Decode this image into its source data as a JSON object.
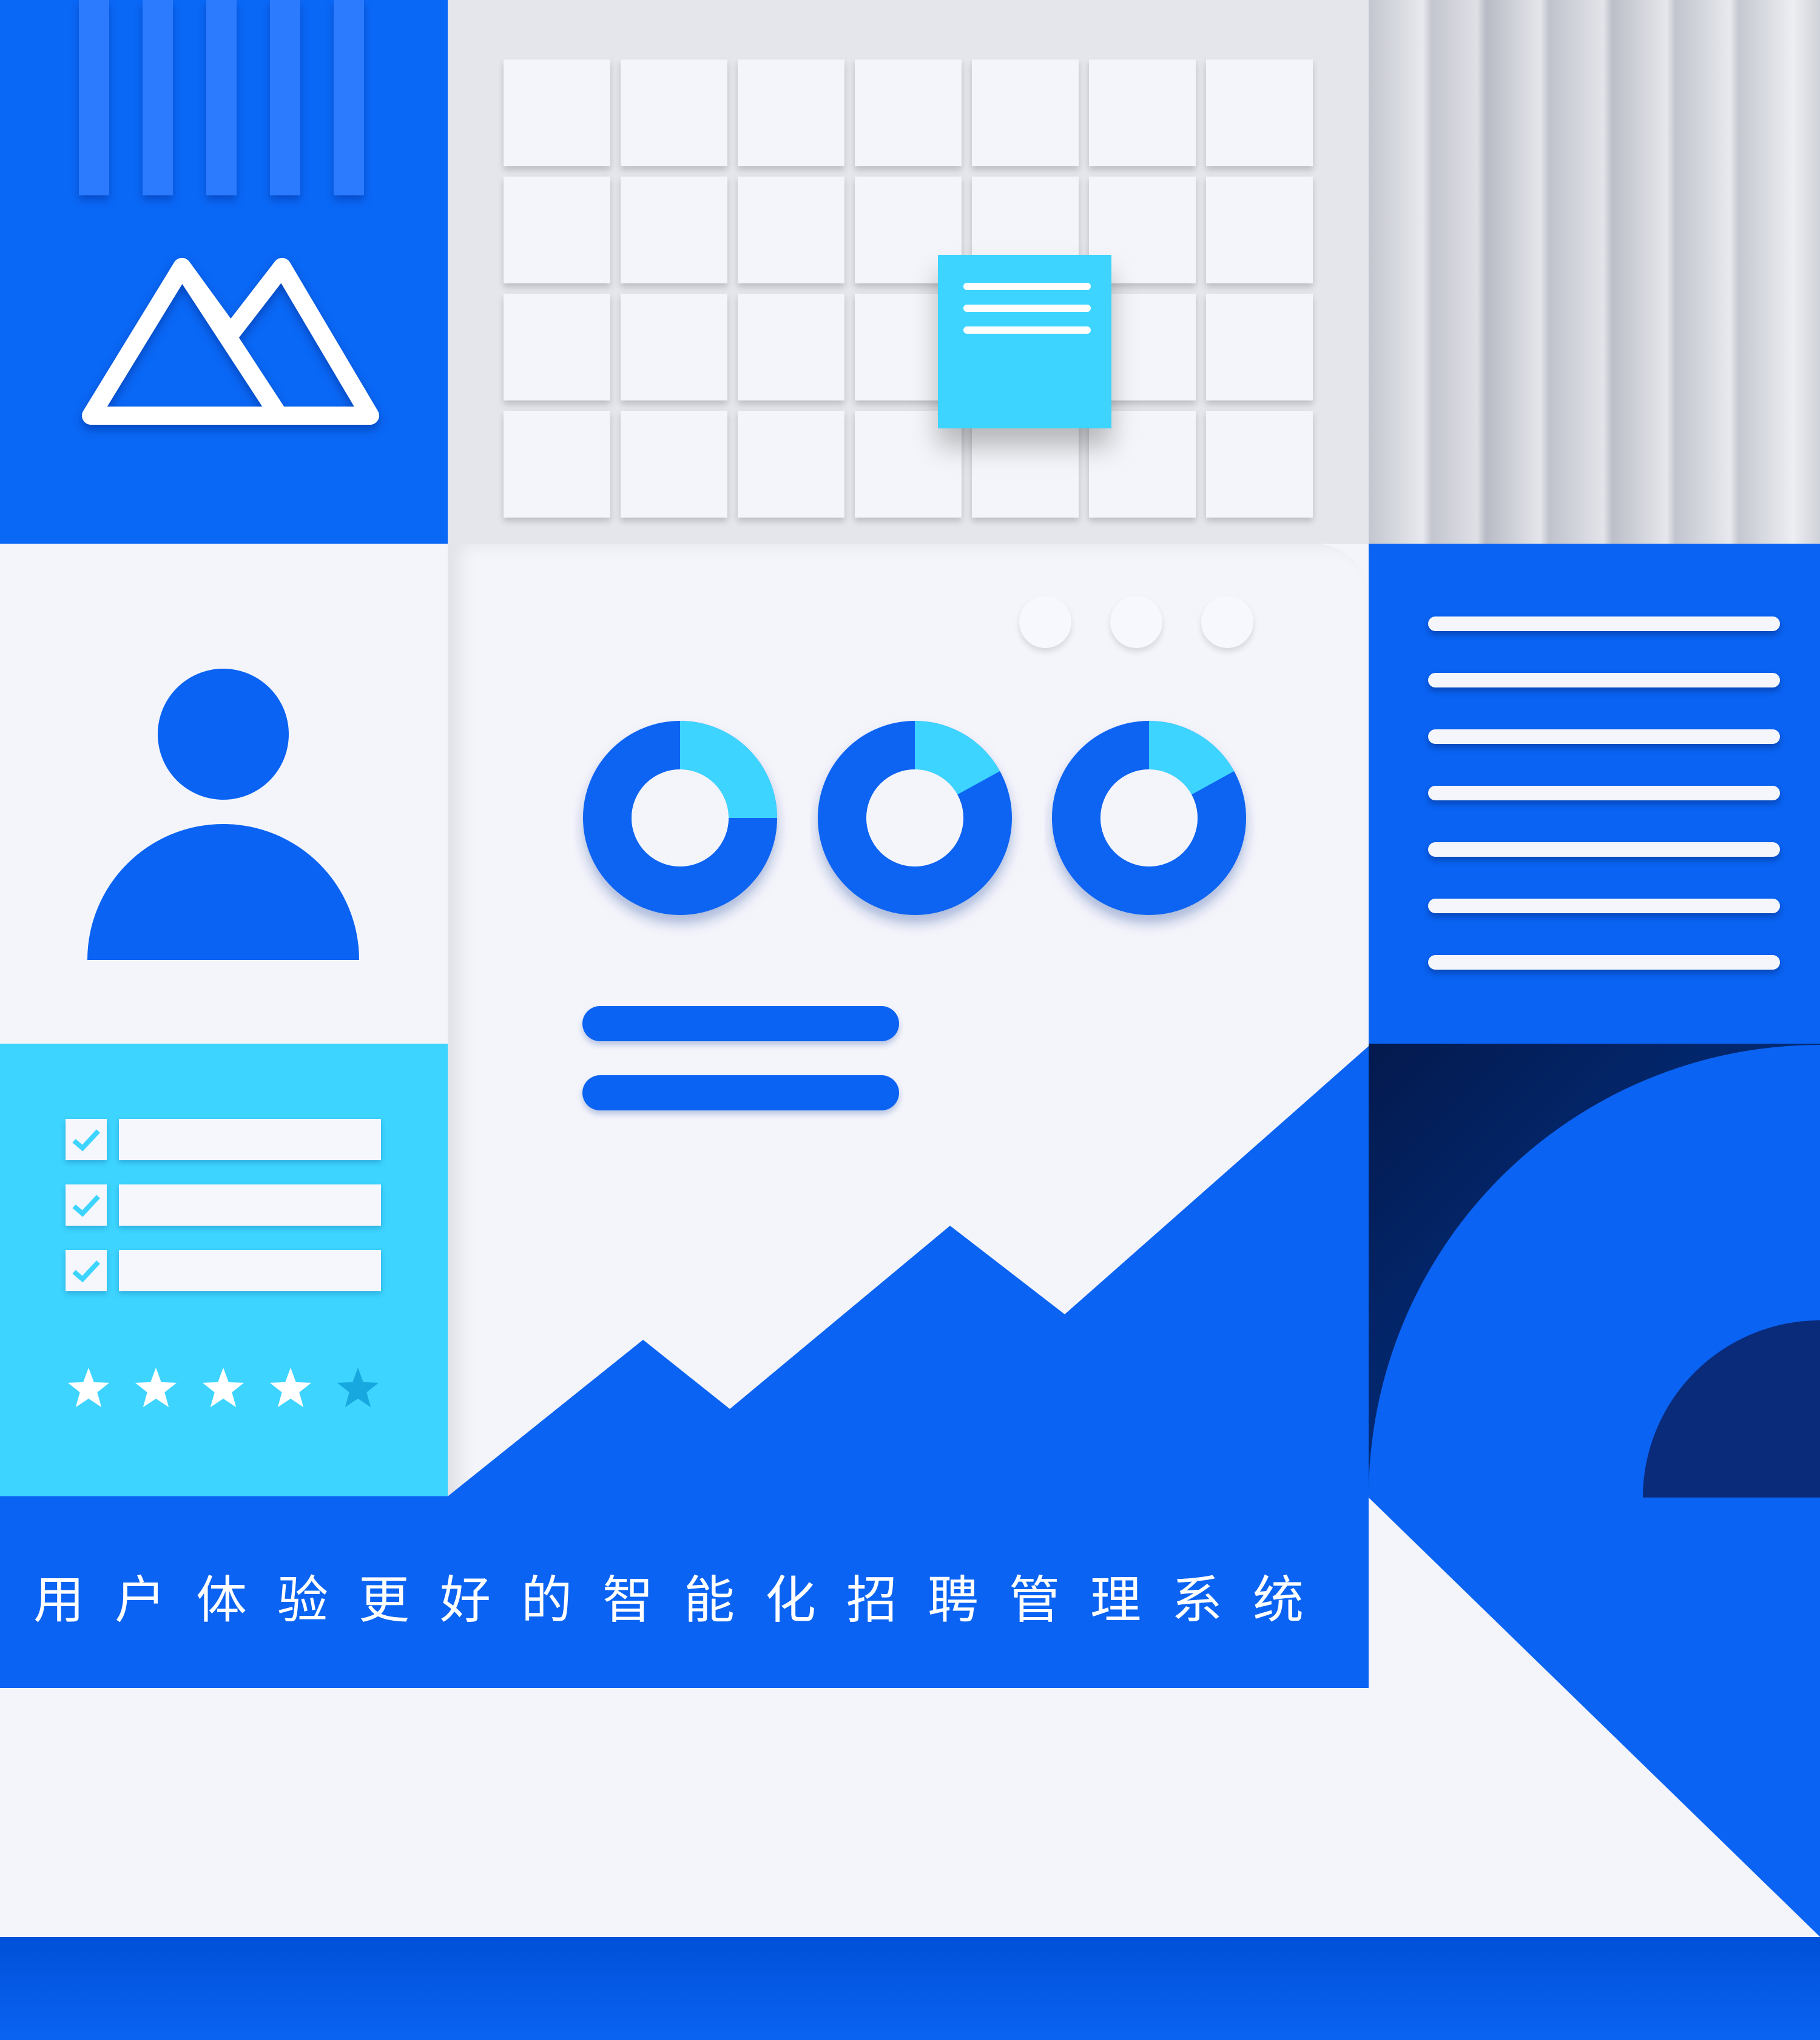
{
  "banner": {
    "tagline": "用户体验更好的智能化招聘管理系统"
  },
  "logo": {
    "icon": "mountain-logo-icon"
  },
  "colors": {
    "primary_blue": "#0a63f2",
    "cyan": "#3dd4ff",
    "dark_navy": "#04205e",
    "panel_light": "#f4f5fa",
    "grey": "#c7c9d3"
  },
  "rating": {
    "value": 4,
    "max": 5
  },
  "checklist": {
    "checked_count": 3
  },
  "donuts": [
    {
      "name": "donut-1",
      "fraction": 0.25
    },
    {
      "name": "donut-2",
      "fraction": 0.17
    },
    {
      "name": "donut-3",
      "fraction": 0.17
    }
  ],
  "window_controls": 3
}
